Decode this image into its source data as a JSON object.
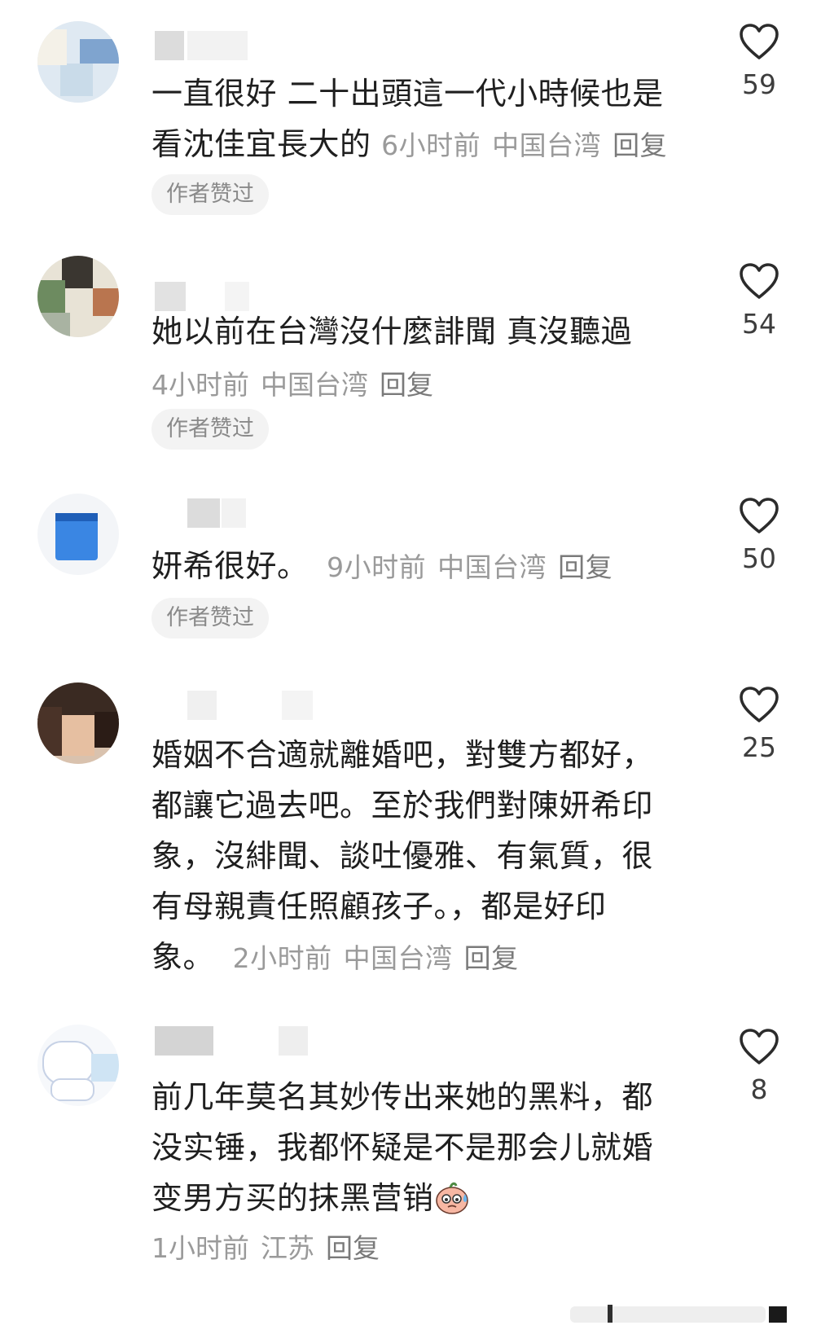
{
  "comments": [
    {
      "text": "一直很好 二十出頭這一代小時候也是看沈佳宜長大的",
      "time": "6小时前",
      "location": "中国台湾",
      "reply": "回复",
      "badge": "作者赞过",
      "likes": "59"
    },
    {
      "text": "她以前在台灣沒什麼誹聞 真沒聽過",
      "time": "4小时前",
      "location": "中国台湾",
      "reply": "回复",
      "badge": "作者赞过",
      "likes": "54"
    },
    {
      "text": "妍希很好。",
      "time": "9小时前",
      "location": "中国台湾",
      "reply": "回复",
      "badge": "作者赞过",
      "likes": "50"
    },
    {
      "text": "婚姻不合適就離婚吧，對雙方都好，都讓它過去吧。至於我們對陳妍希印象，沒緋聞、談吐優雅、有氣質，很有母親責任照顧孩子。，都是好印象。",
      "time": "2小时前",
      "location": "中国台湾",
      "reply": "回复",
      "likes": "25"
    },
    {
      "text": "前几年莫名其妙传出来她的黑料，都没实锤，我都怀疑是不是那会儿就婚变男方买的抹黑营销",
      "time": "1小时前",
      "location": "江苏",
      "reply": "回复",
      "likes": "8",
      "emoji": "sweat-face-emoji"
    }
  ],
  "colors": {
    "text": "#1f1f1f",
    "meta": "#9a9a9a",
    "badge_bg": "#f3f3f3",
    "badge_text": "#8a8a8a",
    "like_count": "#3d3d3d"
  }
}
